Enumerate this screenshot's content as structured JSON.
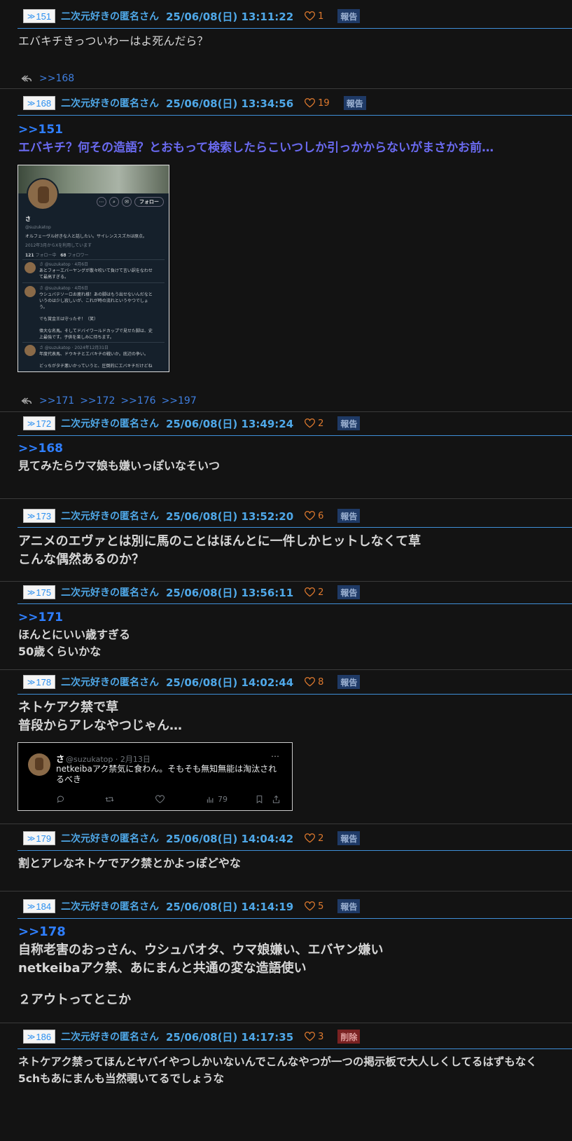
{
  "posts": [
    {
      "id": "151",
      "resnum": "151",
      "author": "二次元好きの匿名さん",
      "date": "25/06/08(日) 13:11:22",
      "likes": "1",
      "report": "報告",
      "lines": [
        "エバキチきっついわーはよ死んだら？"
      ],
      "replies": [
        ">>168"
      ]
    },
    {
      "id": "168",
      "resnum": "168",
      "author": "二次元好きの匿名さん",
      "date": "25/06/08(日) 13:34:56",
      "likes": "19",
      "report": "報告",
      "anchor": ">>151",
      "quote": "エバキチ？何その造語？とおもって検索したらこいつしか引っかからないがまさかお前…",
      "replies": [
        ">>171",
        ">>172",
        ">>176",
        ">>197"
      ]
    },
    {
      "id": "172",
      "resnum": "172",
      "author": "二次元好きの匿名さん",
      "date": "25/06/08(日) 13:49:24",
      "likes": "2",
      "report": "報告",
      "anchor": ">>168",
      "lines": [
        "見てみたらウマ娘も嫌いっぽいなそいつ"
      ]
    },
    {
      "id": "173",
      "resnum": "173",
      "author": "二次元好きの匿名さん",
      "date": "25/06/08(日) 13:52:20",
      "likes": "6",
      "report": "報告",
      "lines": [
        "アニメのエヴァとは別に馬のことはほんとに一件しかヒットしなくて草",
        "こんな偶然あるのか？"
      ]
    },
    {
      "id": "175",
      "resnum": "175",
      "author": "二次元好きの匿名さん",
      "date": "25/06/08(日) 13:56:11",
      "likes": "2",
      "report": "報告",
      "anchor": ">>171",
      "lines": [
        "ほんとにいい歳すぎる",
        "50歳くらいかな"
      ]
    },
    {
      "id": "178",
      "resnum": "178",
      "author": "二次元好きの匿名さん",
      "date": "25/06/08(日) 14:02:44",
      "likes": "8",
      "report": "報告",
      "lines": [
        "ネトケアク禁で草",
        "普段からアレなやつじゃん…"
      ]
    },
    {
      "id": "179",
      "resnum": "179",
      "author": "二次元好きの匿名さん",
      "date": "25/06/08(日) 14:04:42",
      "likes": "2",
      "report": "報告",
      "lines": [
        "割とアレなネトケでアク禁とかよっぽどやな"
      ]
    },
    {
      "id": "184",
      "resnum": "184",
      "author": "二次元好きの匿名さん",
      "date": "25/06/08(日) 14:14:19",
      "likes": "5",
      "report": "報告",
      "anchor": ">>178",
      "lines": [
        "自称老害のおっさん、ウシュバオタ、ウマ娘嫌い、エバヤン嫌い",
        "netkeibaアク禁、あにまんと共通の変な造語使い",
        "",
        "２アウトってとこか"
      ]
    },
    {
      "id": "186",
      "resnum": "186",
      "author": "二次元好きの匿名さん",
      "date": "25/06/08(日) 14:17:35",
      "likes": "3",
      "report": "削除",
      "lines": [
        "ネトケアク禁ってほんとヤバイやつしかいないんでこんなやつが一つの掲示板で大人しくしてるはずもなく",
        "5chもあにまんも当然覗いてるでしょうな"
      ]
    }
  ],
  "screenshot1": {
    "follow_button": "フォロー",
    "name": "さ",
    "handle": "@suzukatop",
    "bio": "オルフェーヴル好きな人と話したい。サイレンススズカは原点。",
    "joined": "2012年3月からXを利用しています",
    "following_count": "121",
    "following_label": "フォロー中",
    "followers_count": "68",
    "followers_label": "フォロワー",
    "tweets": [
      {
        "meta": "さ @suzukatop · 4月6日",
        "text1": "あとフォーエバーヤングが散々吹いて負けて言い訳をなわせ",
        "text2": "て最高すぎる。"
      },
      {
        "meta": "さ @suzukatop · 4月6日",
        "text1": "ウシュバテソーロお疲れ様！あの脚はもう出せないんだなと",
        "text2": "いうのは少し寂しいが、これが時の流れというやつでしょ",
        "text3": "う。",
        "text4": "でも賞金王は守ったぞ！（笑）",
        "text5": "偉大な名馬。そしてドバイワールドカップで見せた脚は、史",
        "text6": "上最強です。子供を楽しみに待ちます。"
      },
      {
        "meta": "さ @suzukatop · 2024年12月31日",
        "text1": "年度代表馬、ドウキチとエバキチの戦いか。底辺の争い。",
        "text2": "どっちがタチ悪いかっていうと、圧倒的にエバキチだけどね"
      }
    ]
  },
  "tweet_embed": {
    "name": "さ",
    "handle": "@suzukatop · 2月13日",
    "text": "netkeibaアク禁気に食わん。そもそも無知無能は淘汰されるべき",
    "views": "79"
  }
}
